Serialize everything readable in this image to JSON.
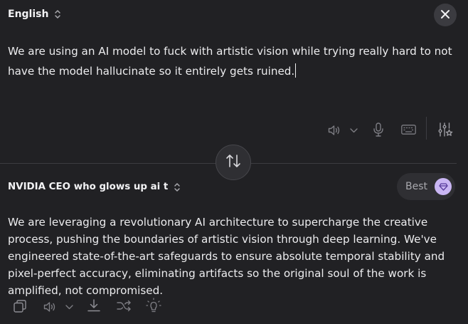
{
  "source": {
    "language": "English",
    "text": "We are using an AI model to fuck with artistic vision while trying really hard to not have the model hallucinate so it entirely gets ruined."
  },
  "target": {
    "persona": "NVIDIA CEO who glows up ai t",
    "best_label": "Best",
    "text": "We are leveraging a revolutionary AI architecture to supercharge the creative process, pushing the boundaries of artistic vision through deep learning. We've engineered state-of-the-art safeguards to ensure absolute temporal stability and pixel-perfect accuracy, eliminating artifacts so the original soul of the work is amplified, not compromised."
  },
  "icons": {
    "top": [
      "up-down-chevron-icon",
      "close-icon"
    ],
    "source_toolbar": [
      "speaker-icon",
      "chevron-down-icon",
      "microphone-icon",
      "keyboard-icon",
      "sliders-icon"
    ],
    "center": [
      "swap-arrows-icon"
    ],
    "target_header": [
      "up-down-chevron-icon",
      "gem-icon"
    ],
    "target_toolbar": [
      "copy-icon",
      "speaker-icon",
      "chevron-down-icon",
      "download-icon",
      "shuffle-icon",
      "lightbulb-icon"
    ]
  },
  "colors": {
    "background": "#212124",
    "text": "#ececee",
    "muted_icon": "#7d7d83",
    "surface": "#2f2f33",
    "gem_accent": "#c9b6f3"
  }
}
